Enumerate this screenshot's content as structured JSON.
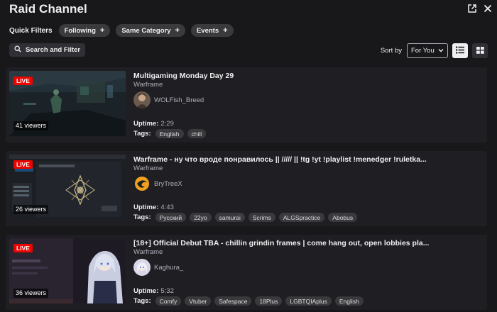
{
  "header": {
    "title": "Raid Channel",
    "icons": [
      "popout-icon",
      "close-icon"
    ]
  },
  "filters": {
    "label": "Quick Filters",
    "chips": [
      {
        "label": "Following",
        "icon": "plus"
      },
      {
        "label": "Same Category",
        "icon": "plus"
      },
      {
        "label": "Events",
        "icon": "plus"
      }
    ],
    "search_button": "Search and Filter",
    "sort_label": "Sort by",
    "sort_value": "For You",
    "view_modes": [
      "list-view",
      "grid-view"
    ],
    "active_view": "list-view"
  },
  "colors": {
    "live": "#eb0400",
    "background": "#18181b",
    "card": "#1f1f23",
    "chip": "#3a3a3d"
  },
  "streams": [
    {
      "live_badge": "LIVE",
      "viewers": "41 viewers",
      "title": "Multigaming Monday Day 29",
      "game": "Warframe",
      "channel": "WOLFish_Breed",
      "uptime_label": "Uptime:",
      "uptime": "2:29",
      "tags_label": "Tags:",
      "tags": [
        "English",
        "chill"
      ]
    },
    {
      "live_badge": "LIVE",
      "viewers": "26 viewers",
      "title": "Warframe - ну что вроде понравилось || ///// || !tg !yt !playlist !menedger !ruletka...",
      "game": "Warframe",
      "channel": "BryTreeX",
      "uptime_label": "Uptime:",
      "uptime": "4:43",
      "tags_label": "Tags:",
      "tags": [
        "Русский",
        "22yo",
        "samurai",
        "Scrims",
        "ALGSpractice",
        "Abobus"
      ]
    },
    {
      "live_badge": "LIVE",
      "viewers": "36 viewers",
      "title": "[18+] Official Debut TBA - chillin grindin frames | come hang out, open lobbies pla...",
      "game": "Warframe",
      "channel": "Kaghura_",
      "uptime_label": "Uptime:",
      "uptime": "5:32",
      "tags_label": "Tags:",
      "tags": [
        "Comfy",
        "Vtuber",
        "Safespace",
        "18Plus",
        "LGBTQIAplus",
        "English"
      ]
    }
  ]
}
